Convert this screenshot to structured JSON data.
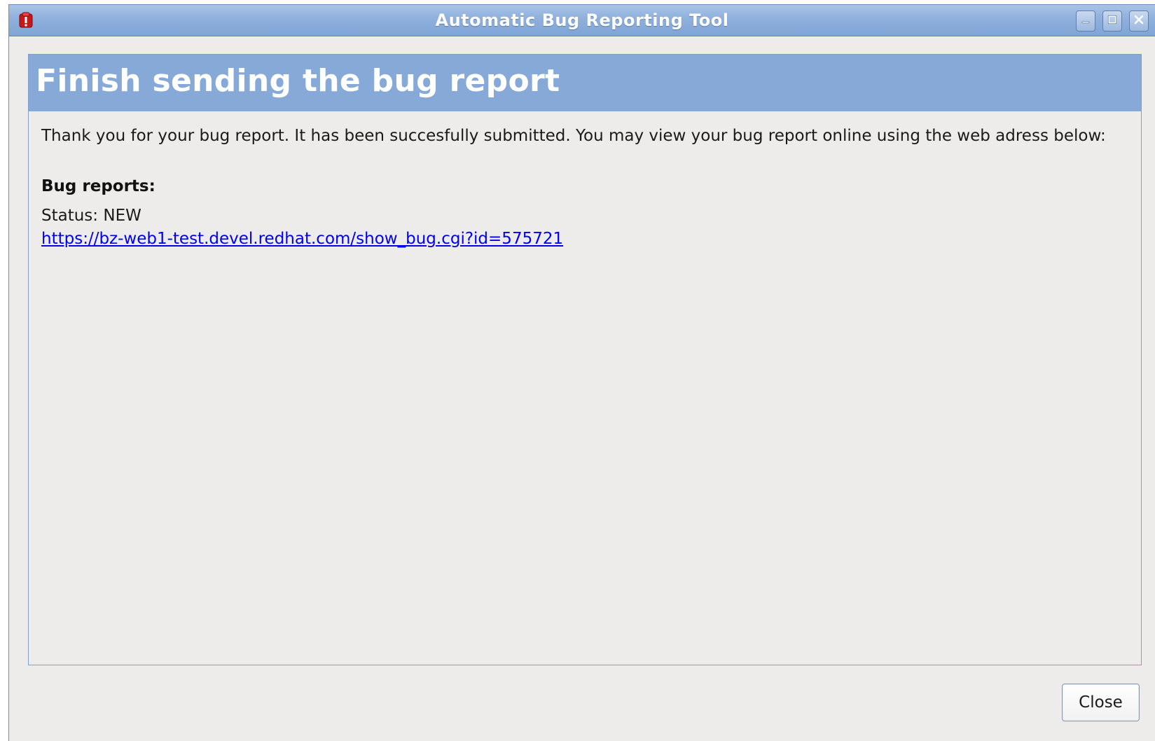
{
  "window": {
    "title": "Automatic Bug Reporting Tool",
    "app_icon": "bug-alert-icon",
    "controls": {
      "minimize_icon": "minimize-icon",
      "maximize_icon": "maximize-icon",
      "close_icon": "close-icon"
    }
  },
  "page": {
    "header": "Finish sending the bug report",
    "message": "Thank you for your bug report. It has been succesfully submitted. You may view your bug report online using the web adress below:",
    "bug_reports_heading": "Bug reports:",
    "status_label": "Status:",
    "status_value": "NEW",
    "bug_url": "https://bz-web1-test.devel.redhat.com/show_bug.cgi?id=575721"
  },
  "footer": {
    "close_label": "Close"
  },
  "colors": {
    "titlebar": "#8fb0dc",
    "header_band": "#86a9d8",
    "window_bg": "#edeceb",
    "link": "#0000ee",
    "icon_red": "#d42020"
  }
}
